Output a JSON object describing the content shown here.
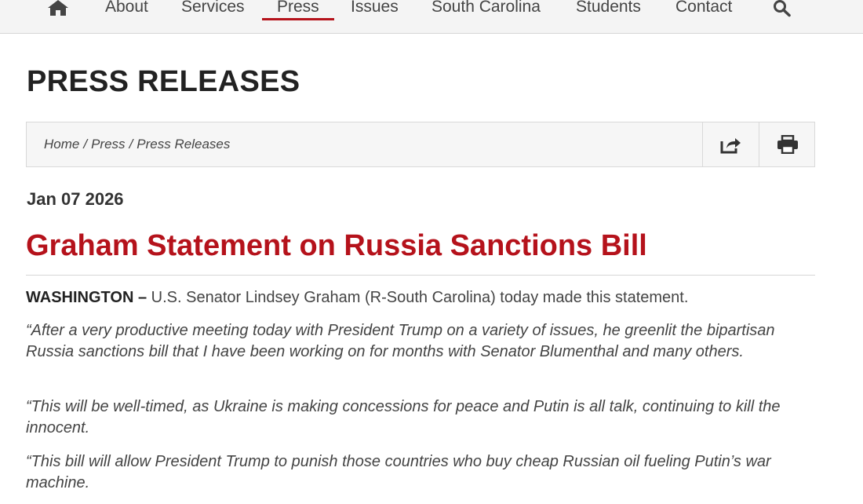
{
  "nav": {
    "items": [
      "About",
      "Services",
      "Press",
      "Issues",
      "South Carolina",
      "Students",
      "Contact"
    ],
    "active": "Press"
  },
  "page": {
    "title": "PRESS RELEASES"
  },
  "breadcrumb": {
    "items": [
      "Home",
      "Press",
      "Press Releases"
    ],
    "separator": "/"
  },
  "article": {
    "date": "Jan 07 2026",
    "headline": "Graham Statement on Russia Sanctions Bill",
    "dateline": "WASHINGTON –",
    "intro": " U.S. Senator Lindsey Graham (R-South Carolina) today made this statement.",
    "quotes": [
      "“After a very productive meeting today with President Trump on a variety of issues, he greenlit the bipartisan Russia sanctions bill that I have been working on for months with Senator Blumenthal and many others.",
      "“This will be well-timed, as Ukraine is making concessions for peace and Putin is all talk, continuing to kill the innocent.",
      "“This bill will allow President Trump to punish those countries who buy cheap Russian oil fueling Putin’s war machine."
    ]
  },
  "icons": {
    "home": "home-icon",
    "search": "search-icon",
    "share": "share-icon",
    "print": "print-icon"
  },
  "colors": {
    "accent": "#b5121b",
    "nav_bg": "#f4f4f4",
    "text": "#444444"
  }
}
